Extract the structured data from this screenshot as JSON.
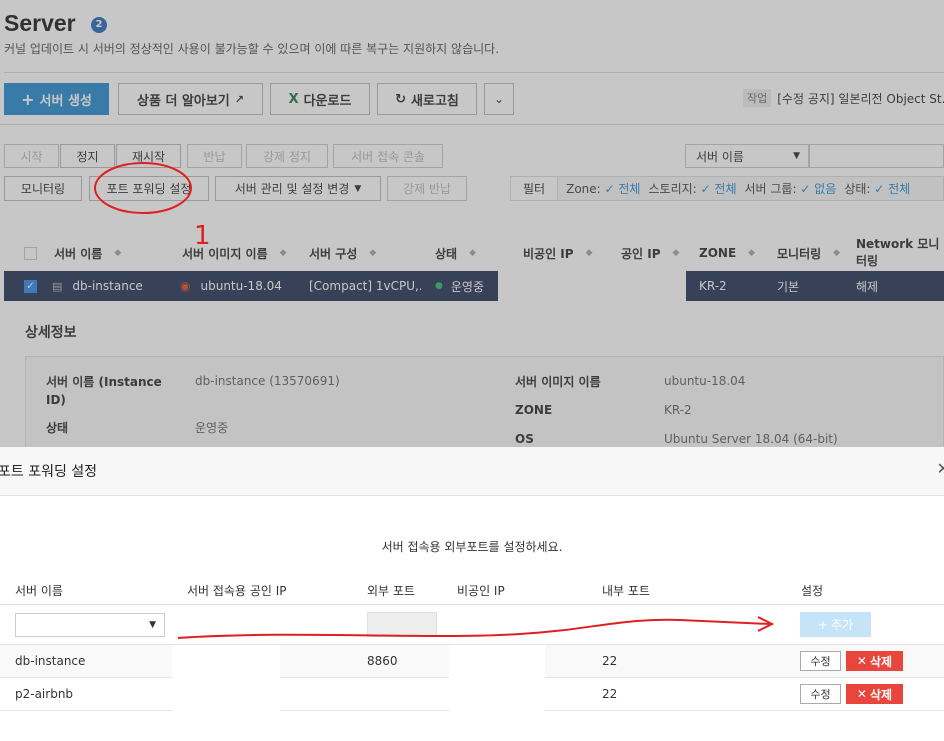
{
  "page": {
    "title": "Server",
    "badge_count": "2",
    "subtitle": "커널 업데이트 시 서버의 정상적인 사용이 불가능할 수 있으며 이에 따른 복구는 지원하지 않습니다."
  },
  "toolbar": {
    "create_label": "서버 생성",
    "learn_more_label": "상품 더 알아보기",
    "download_label": "다운로드",
    "refresh_label": "새로고침",
    "notice_tag": "작업",
    "notice_text": "[수정 공지] 일본리전 Object St..."
  },
  "actions": {
    "start": "시작",
    "stop": "정지",
    "restart": "재시작",
    "return": "반납",
    "force_stop": "강제 정지",
    "console": "서버 접속 콘솔",
    "monitoring": "모니터링",
    "port_forwarding": "포트 포워딩 설정",
    "manage": "서버 관리 및 설정 변경",
    "force_return": "강제 반납"
  },
  "search": {
    "select_value": "서버 이름"
  },
  "filter": {
    "label": "필터",
    "items": [
      {
        "key": "Zone:",
        "value": "전체"
      },
      {
        "key": "스토리지:",
        "value": "전체"
      },
      {
        "key": "서버 그룹:",
        "value": "없음"
      },
      {
        "key": "상태:",
        "value": "전체"
      }
    ]
  },
  "table": {
    "columns": [
      "서버 이름",
      "서버 이미지 이름",
      "서버 구성",
      "상태",
      "비공인 IP",
      "공인 IP",
      "ZONE",
      "모니터링",
      "Network 모니터링"
    ],
    "columns_network_line1": "Network 모니",
    "columns_network_line2": "터링",
    "row": {
      "name": "db-instance",
      "image": "ubuntu-18.04",
      "spec": "[Compact] 1vCPU,...",
      "status": "운영중",
      "zone": "KR-2",
      "monitoring": "기본",
      "network_monitoring": "해제"
    }
  },
  "detail": {
    "title": "상세정보",
    "fields": {
      "name_key": "서버 이름 (Instance ID)",
      "name_key_line1": "서버 이름 (Instance",
      "name_key_line2": "ID)",
      "name_value": "db-instance (13570691)",
      "status_key": "상태",
      "status_value": "운영중",
      "image_key": "서버 이미지 이름",
      "image_value": "ubuntu-18.04",
      "zone_key": "ZONE",
      "zone_value": "KR-2",
      "os_key": "OS",
      "os_value": "Ubuntu Server 18.04 (64-bit)"
    }
  },
  "modal": {
    "title": "포트 포워딩 설정",
    "message": "서버 접속용 외부포트를 설정하세요.",
    "columns": [
      "서버 이름",
      "서버 접속용 공인 IP",
      "외부 포트",
      "비공인 IP",
      "내부 포트",
      "설정"
    ],
    "add_label": "추가",
    "rows": [
      {
        "name": "db-instance",
        "external_port": "8860",
        "internal_port": "22",
        "edit": "수정",
        "delete": "삭제"
      },
      {
        "name": "p2-airbnb",
        "external_port": "",
        "internal_port": "22",
        "edit": "수정",
        "delete": "삭제"
      }
    ]
  },
  "annotation": {
    "number": "1"
  },
  "colors": {
    "primary": "#2e8fd1",
    "selected_row": "#2c3a5c",
    "delete": "#e8453c",
    "annotation": "#e02020"
  }
}
